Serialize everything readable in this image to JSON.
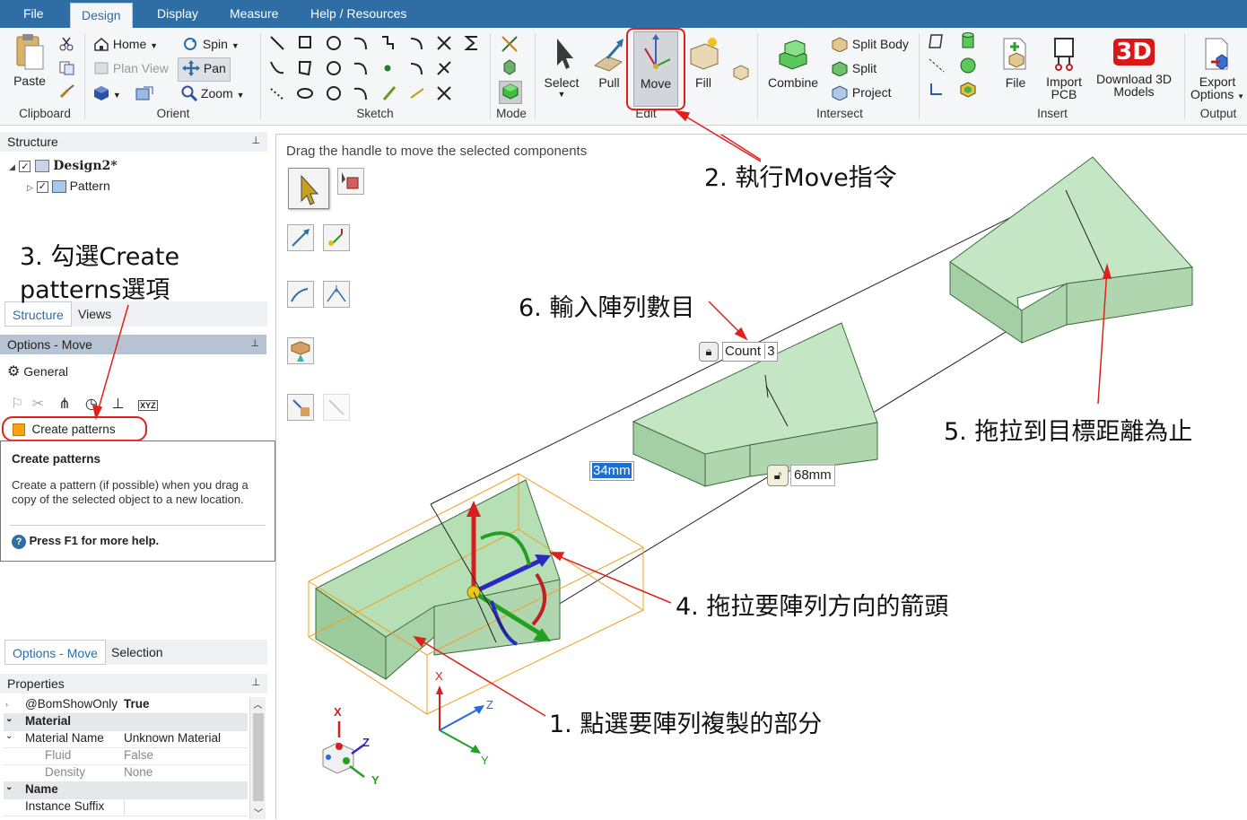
{
  "menu": {
    "tabs": [
      "File",
      "Design",
      "Display",
      "Measure",
      "Help / Resources"
    ],
    "active": "Design"
  },
  "ribbon": {
    "clipboard": {
      "paste": "Paste",
      "group": "Clipboard"
    },
    "orient": {
      "home": "Home",
      "spin": "Spin",
      "plan_view": "Plan View",
      "pan": "Pan",
      "zoom": "Zoom",
      "group": "Orient"
    },
    "sketch": {
      "group": "Sketch"
    },
    "mode": {
      "group": "Mode"
    },
    "edit": {
      "select": "Select",
      "pull": "Pull",
      "move": "Move",
      "fill": "Fill",
      "group": "Edit"
    },
    "intersect": {
      "combine": "Combine",
      "split_body": "Split Body",
      "split": "Split",
      "project": "Project",
      "group": "Intersect"
    },
    "insert": {
      "file": "File",
      "import_pcb_1": "Import",
      "import_pcb_2": "PCB",
      "download_1": "Download 3D",
      "download_2": "Models",
      "badge": "3D",
      "group": "Insert"
    },
    "output": {
      "export_1": "Export",
      "export_2": "Options",
      "group": "Output"
    }
  },
  "structure": {
    "title": "Structure",
    "tree": [
      {
        "label": "Design2*"
      },
      {
        "label": "Pattern"
      }
    ],
    "tabs": [
      "Structure",
      "Views"
    ]
  },
  "options": {
    "title": "Options - Move",
    "general": "General",
    "toolbar_xyz": "XYZ",
    "create_patterns": "Create patterns",
    "tooltip": {
      "title": "Create patterns",
      "body": "Create a pattern (if possible) when you drag a copy of the selected object to a new location.",
      "help": "Press F1 for more help."
    },
    "tabs": [
      "Options - Move",
      "Selection"
    ]
  },
  "properties": {
    "title": "Properties",
    "rows": [
      {
        "name": "@BomShowOnly",
        "value": "True",
        "type": "row",
        "bold_value": true
      },
      {
        "name": "Material",
        "value": "",
        "type": "cat"
      },
      {
        "name": "Material Name",
        "value": "Unknown Material",
        "type": "row"
      },
      {
        "name": "Fluid",
        "value": "False",
        "type": "sub"
      },
      {
        "name": "Density",
        "value": "None",
        "type": "sub"
      },
      {
        "name": "Name",
        "value": "",
        "type": "cat"
      },
      {
        "name": "Instance Suffix",
        "value": "",
        "type": "row"
      }
    ]
  },
  "viewport": {
    "hint": "Drag the handle to move the selected components",
    "count_label": "Count",
    "count_value": "3",
    "dim_spacing": "34mm",
    "dim_total": "68mm",
    "axis_labels": {
      "x": "X",
      "y": "Y",
      "z": "Z"
    }
  },
  "annotations": {
    "a1": "1. 點選要陣列複製的部分",
    "a2": "2. 執行Move指令",
    "a3_line1": "3. 勾選Create",
    "a3_line2": "patterns選項",
    "a4": "4. 拖拉要陣列方向的箭頭",
    "a5": "5. 拖拉到目標距離為止",
    "a6": "6. 輸入陣列數目"
  },
  "colors": {
    "accent": "#2f6ea5",
    "annotation_red": "#e0201b",
    "solid_green": "#a8d8a8",
    "selection_orange": "#f0a020"
  }
}
